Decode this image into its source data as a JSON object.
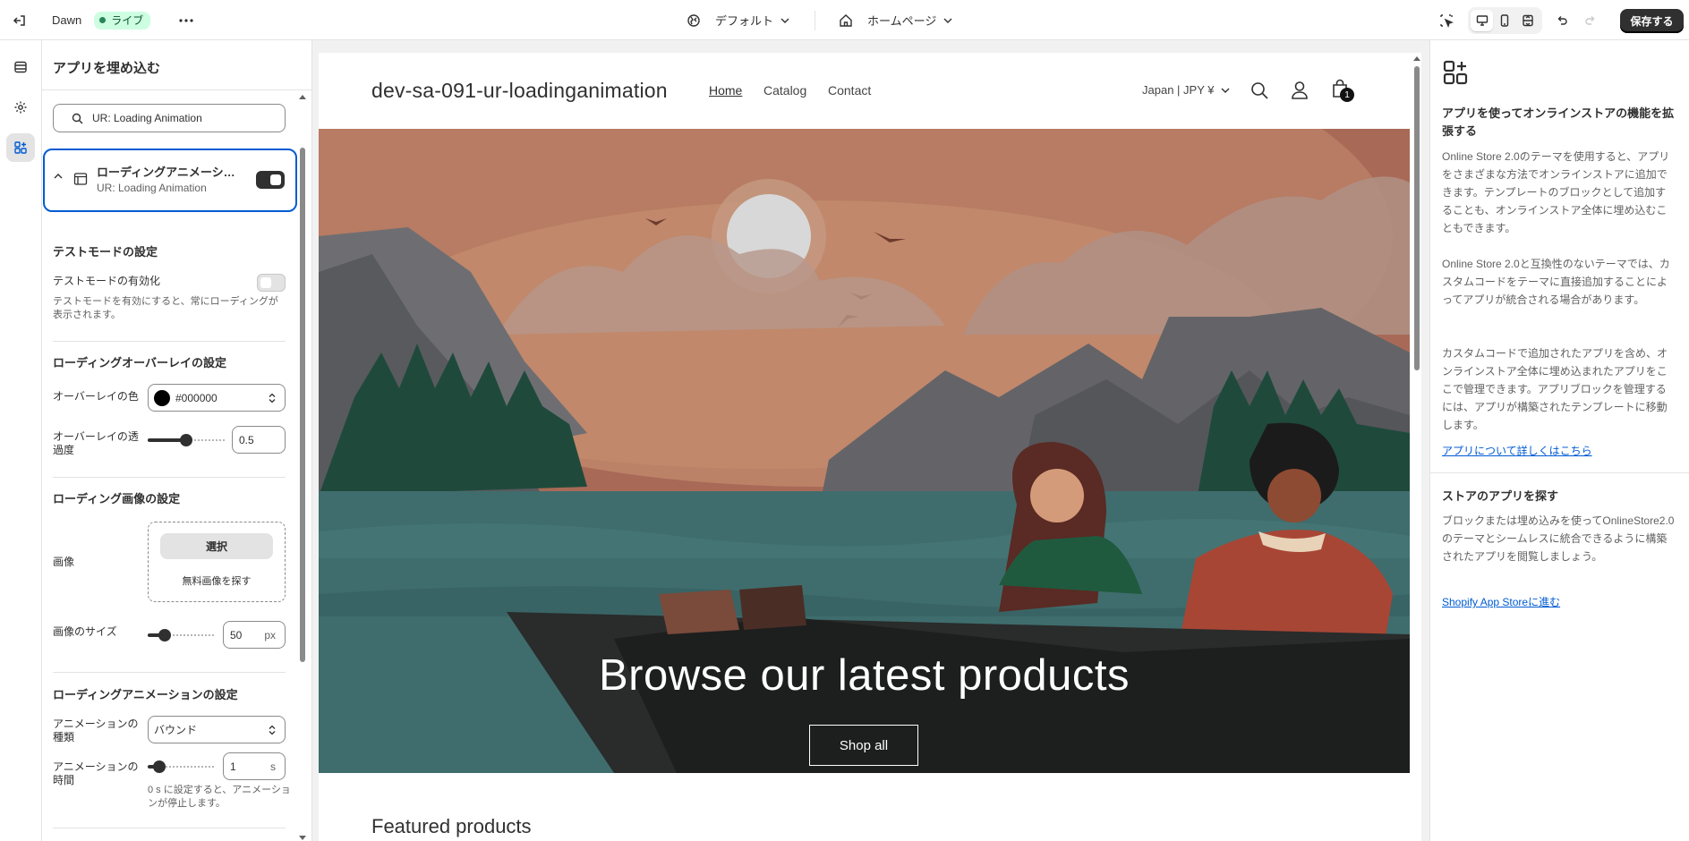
{
  "topbar": {
    "theme_name": "Dawn",
    "live_label": "ライブ",
    "preset_label": "デフォルト",
    "page_label": "ホームページ",
    "save_label": "保存する"
  },
  "left_panel": {
    "title": "アプリを埋め込む",
    "search_value": "UR: Loading Animation",
    "app": {
      "title": "ローディングアニメーション",
      "subtitle": "UR: Loading Animation",
      "enabled": true
    },
    "test_mode": {
      "heading": "テストモードの設定",
      "label": "テストモードの有効化",
      "help": "テストモードを有効にすると、常にローディングが表示されます。",
      "enabled": false
    },
    "overlay": {
      "heading": "ローディングオーバーレイの設定",
      "color_label": "オーバーレイの色",
      "color_value": "#000000",
      "opacity_label": "オーバーレイの透過度",
      "opacity_value": "0.5"
    },
    "image": {
      "heading": "ローディング画像の設定",
      "image_label": "画像",
      "select_label": "選択",
      "free_label": "無料画像を探す",
      "size_label": "画像のサイズ",
      "size_value": "50",
      "size_unit": "px"
    },
    "animation": {
      "heading": "ローディングアニメーションの設定",
      "type_label": "アニメーションの種類",
      "type_value": "バウンド",
      "duration_label": "アニメーションの時間",
      "duration_value": "1",
      "duration_unit": "s",
      "duration_help": "0 s に設定すると、アニメーションが停止します。"
    }
  },
  "preview": {
    "store_name": "dev-sa-091-ur-loadinganimation",
    "nav": [
      "Home",
      "Catalog",
      "Contact"
    ],
    "currency": "Japan | JPY ¥",
    "cart_count": "1",
    "hero_title": "Browse our latest products",
    "hero_button": "Shop all",
    "featured": "Featured products"
  },
  "right_panel": {
    "heading1": "アプリを使ってオンラインストアの機能を拡張する",
    "p1": "Online Store 2.0のテーマを使用すると、アプリをさまざまな方法でオンラインストアに追加できます。テンプレートのブロックとして追加することも、オンラインストア全体に埋め込むこともできます。",
    "p2": "Online Store 2.0と互換性のないテーマでは、カスタムコードをテーマに直接追加することによってアプリが統合される場合があります。",
    "p3": "カスタムコードで追加されたアプリを含め、オンラインストア全体に埋め込まれたアプリをここで管理できます。アプリブロックを管理するには、アプリが構築されたテンプレートに移動します。",
    "link1": "アプリについて詳しくはこちら",
    "heading2": "ストアのアプリを探す",
    "p4": "ブロックまたは埋め込みを使ってOnlineStore2.0のテーマとシームレスに統合できるように構築されたアプリを閲覧しましょう。",
    "link2": "Shopify App Storeに進む"
  },
  "icons": [
    "exit-icon",
    "more-icon",
    "globe-icon",
    "home-icon",
    "inspector-icon",
    "desktop-icon",
    "mobile-icon",
    "fullwidth-icon",
    "undo-icon",
    "redo-icon",
    "sections-icon",
    "gear-icon",
    "apps-icon",
    "search-icon",
    "user-icon",
    "cart-icon"
  ]
}
